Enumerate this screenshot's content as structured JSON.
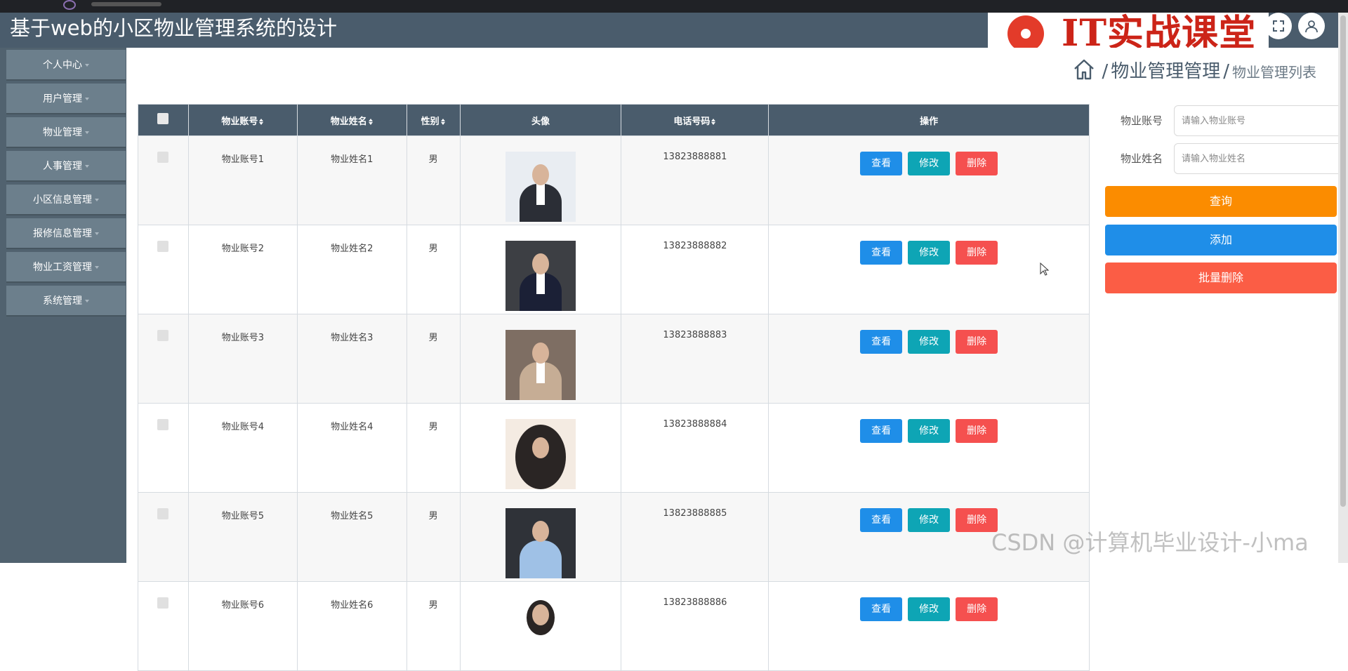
{
  "app": {
    "title": "基于web的小区物业管理系统的设计"
  },
  "brand": {
    "text": "IT实战课堂"
  },
  "sidebar": {
    "items": [
      {
        "label": "个人中心"
      },
      {
        "label": "用户管理"
      },
      {
        "label": "物业管理"
      },
      {
        "label": "人事管理"
      },
      {
        "label": "小区信息管理"
      },
      {
        "label": "报修信息管理"
      },
      {
        "label": "物业工资管理"
      },
      {
        "label": "系统管理"
      }
    ]
  },
  "breadcrumb": {
    "sep": "/",
    "section": "物业管理管理",
    "page": "物业管理列表"
  },
  "table": {
    "headers": {
      "account": "物业账号",
      "name": "物业姓名",
      "gender": "性别",
      "avatar": "头像",
      "phone": "电话号码",
      "ops": "操作"
    },
    "actions": {
      "view": "查看",
      "edit": "修改",
      "del": "删除"
    },
    "rows": [
      {
        "account": "物业账号1",
        "name": "物业姓名1",
        "gender": "男",
        "phone": "13823888881"
      },
      {
        "account": "物业账号2",
        "name": "物业姓名2",
        "gender": "男",
        "phone": "13823888882"
      },
      {
        "account": "物业账号3",
        "name": "物业姓名3",
        "gender": "男",
        "phone": "13823888883"
      },
      {
        "account": "物业账号4",
        "name": "物业姓名4",
        "gender": "男",
        "phone": "13823888884"
      },
      {
        "account": "物业账号5",
        "name": "物业姓名5",
        "gender": "男",
        "phone": "13823888885"
      },
      {
        "account": "物业账号6",
        "name": "物业姓名6",
        "gender": "男",
        "phone": "13823888886"
      }
    ]
  },
  "search": {
    "account_label": "物业账号",
    "account_placeholder": "请输入物业账号",
    "name_label": "物业姓名",
    "name_placeholder": "请输入物业姓名",
    "query_button": "查询",
    "add_button": "添加",
    "batch_delete_button": "批量删除"
  },
  "watermark": "CSDN @计算机毕业设计-小ma",
  "colors": {
    "header": "#4a5c6c",
    "view": "#1f8ee8",
    "edit": "#0ea5b5",
    "delete": "#f5504f",
    "query": "#fb8c00"
  },
  "icons": [
    "home-icon",
    "expand-icon",
    "user-icon",
    "logo-icon",
    "cursor-icon"
  ]
}
